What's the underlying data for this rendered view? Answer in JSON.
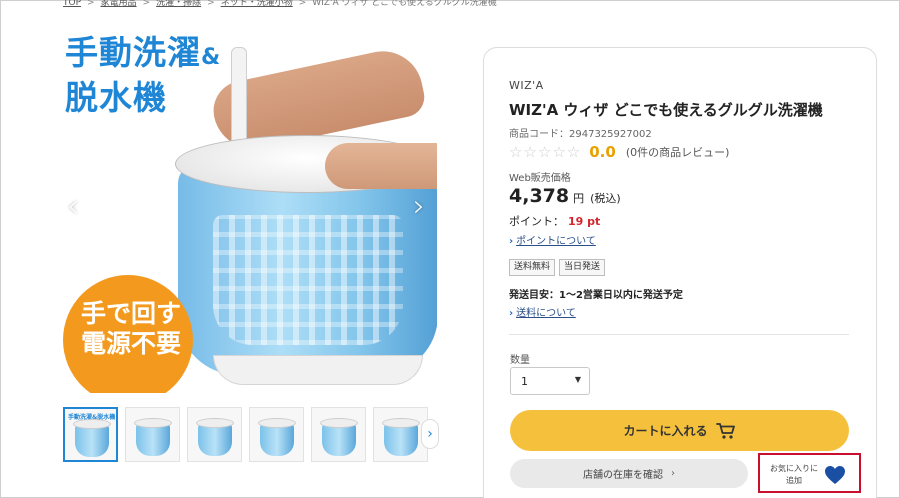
{
  "breadcrumb": {
    "items": [
      "TOP",
      "家電用品",
      "洗濯・掃除",
      "ネット・洗濯小物"
    ],
    "current": "WIZ'A ウィザ どこでも使えるグルグル洗濯機",
    "separator": ">"
  },
  "gallery": {
    "promo_title_line1": "手動洗濯",
    "promo_title_amp": "&",
    "promo_title_line2": "脱水機",
    "promo_circle_line1": "手で回す",
    "promo_circle_line2": "電源不要",
    "prev_icon": "‹",
    "next_icon": "›",
    "thumb_next_icon": "›",
    "thumbnail_count": 7,
    "thumb_caption": "手動洗濯&脱水機"
  },
  "product": {
    "brand": "WIZ'A",
    "title": "WIZ'A ウィザ どこでも使えるグルグル洗濯機",
    "code": "商品コード：2947325927002",
    "stars": "☆☆☆☆☆",
    "rating": "0.0",
    "review_count": "(0件の商品レビュー)",
    "price_label": "Web販売価格",
    "price": "4,378",
    "price_unit": "円",
    "price_tax": "(税込)",
    "points_label": "ポイント：",
    "points_value": "19 pt",
    "points_link": "ポイントについて",
    "tags": [
      "送料無料",
      "当日発送"
    ],
    "ship_estimate": "発送目安：1〜2営業日以内に発送予定",
    "shipping_link": "送料について",
    "quantity_label": "数量",
    "quantity_value": "1",
    "cart_button": "カートに入れる",
    "stock_button": "店舗の在庫を確認",
    "favorite_line1": "お気に入りに",
    "favorite_line2": "追加"
  },
  "colors": {
    "accent_blue": "#1f86d6",
    "cart_yellow": "#f5c13c",
    "points_red": "#d3262d",
    "rating_gold": "#e8a100",
    "highlight_red": "#c8102e",
    "heart_blue": "#1a4fa3"
  }
}
